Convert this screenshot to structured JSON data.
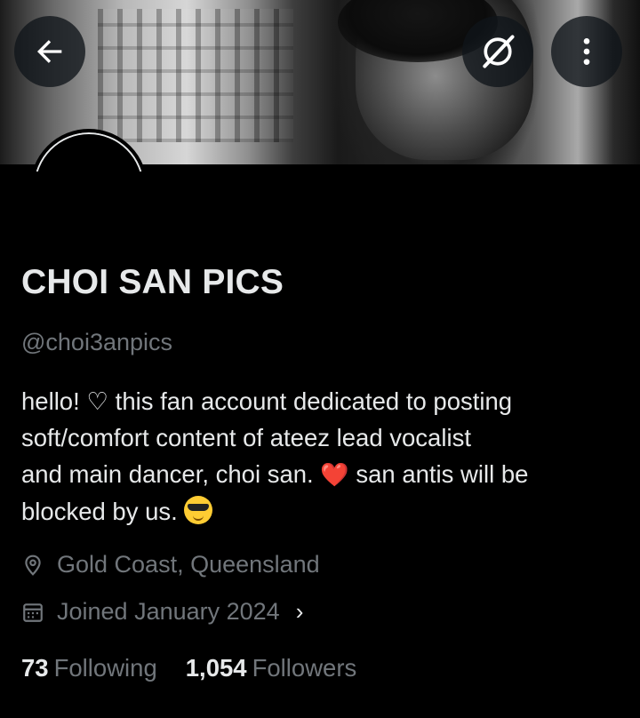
{
  "profile": {
    "display_name": "CHOI SAN PICS",
    "handle": "@choi3anpics",
    "bio_line1": "hello!  ♡ this fan account dedicated to posting",
    "bio_line2": "soft/comfort content of ateez lead vocalist",
    "bio_line3_a": "and main dancer, choi san. ",
    "bio_line3_b": " san antis will be",
    "bio_line4": "blocked by us. ",
    "heart_emoji": "❤️",
    "location": "Gold Coast, Queensland",
    "joined": "Joined January 2024",
    "following_count": "73",
    "following_label": "Following",
    "followers_count": "1,054",
    "followers_label": "Followers"
  },
  "icons": {
    "back": "arrow-left-icon",
    "grok": "grok-icon",
    "more": "more-vertical-icon",
    "location": "location-pin-icon",
    "calendar": "calendar-icon",
    "chevron": "chevron-right-icon"
  },
  "colors": {
    "background": "#000000",
    "text_primary": "#e7e9ea",
    "text_secondary": "#71767b",
    "heart": "#e0245e"
  }
}
